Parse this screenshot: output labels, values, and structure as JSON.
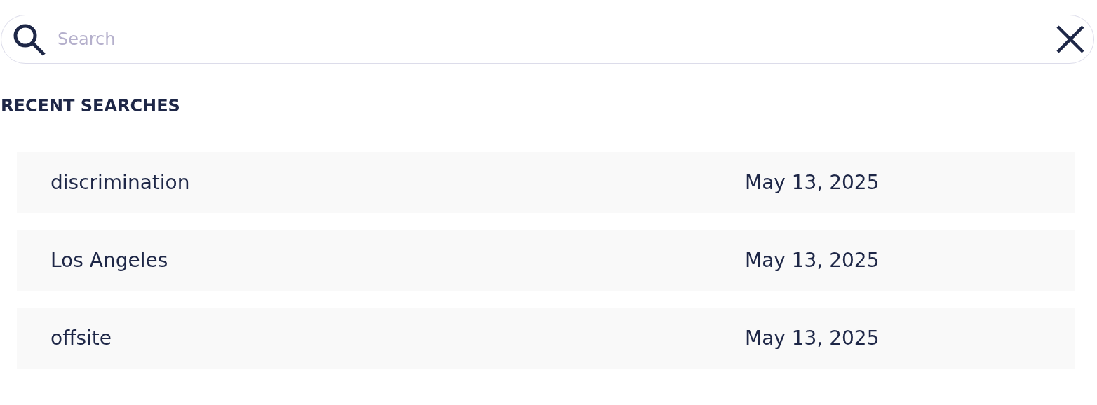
{
  "search": {
    "placeholder": "Search"
  },
  "recent_searches": {
    "heading": "RECENT SEARCHES",
    "items": [
      {
        "query": "discrimination",
        "date": "May 13, 2025"
      },
      {
        "query": "Los Angeles",
        "date": "May 13, 2025"
      },
      {
        "query": "offsite",
        "date": "May 13, 2025"
      }
    ]
  }
}
